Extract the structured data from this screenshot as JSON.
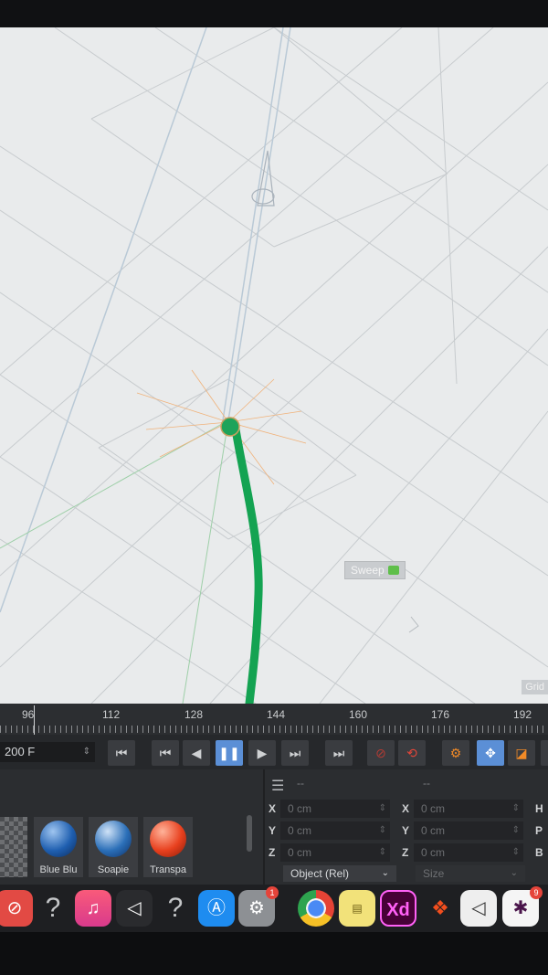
{
  "viewport": {
    "object_label": "Sweep",
    "grid_label": "Grid"
  },
  "timeline": {
    "ruler_numbers": [
      "96",
      "112",
      "128",
      "144",
      "160",
      "176",
      "192"
    ],
    "frame_field": "200 F"
  },
  "transport": {
    "buttons": [
      "go-to-start",
      "prev-key",
      "prev-frame",
      "pause",
      "next-frame",
      "next-key",
      "go-to-end",
      "record",
      "autokey",
      "keyframe-settings",
      "move",
      "scale"
    ]
  },
  "attributes": {
    "left_header": "--",
    "right_header": "--",
    "rows": [
      {
        "axis": "X",
        "value": "0 cm",
        "axis2": "X",
        "value2": "0 cm",
        "axis3": "H"
      },
      {
        "axis": "Y",
        "value": "0 cm",
        "axis2": "Y",
        "value2": "0 cm",
        "axis3": "P"
      },
      {
        "axis": "Z",
        "value": "0 cm",
        "axis2": "Z",
        "value2": "0 cm",
        "axis3": "B"
      }
    ],
    "coord_mode": "Object (Rel)",
    "size_mode": "Size"
  },
  "materials": [
    {
      "label": "Blue Blu",
      "color": "#1f5fb0"
    },
    {
      "label": "Soapie",
      "color": "#2b6fb8"
    },
    {
      "label": "Transpa",
      "color": "#e8401e"
    }
  ],
  "dock": {
    "apps": [
      "News",
      "Help",
      "Music",
      "Unity",
      "Help",
      "App Store",
      "System Preferences",
      "Chrome",
      "Stickies",
      "Xd",
      "Figma",
      "Unity Hub",
      "Slack"
    ],
    "xd_label": "Xd",
    "help_glyph": "?",
    "prefs_badge": "1",
    "slack_badge": "9"
  }
}
